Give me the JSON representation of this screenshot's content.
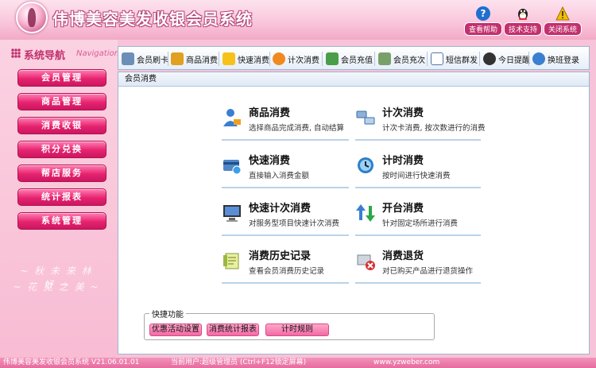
{
  "header": {
    "title": "伟博美容美发收银会员系统",
    "buttons": [
      {
        "label": "查看帮助",
        "icon": "help-icon",
        "color": "#1e6fd0"
      },
      {
        "label": "技术支持",
        "icon": "qq-penguin-icon",
        "color": "#222222"
      },
      {
        "label": "关闭系统",
        "icon": "warning-icon",
        "color": "#f0c000"
      }
    ]
  },
  "sidebar": {
    "title": "系统导航",
    "title_en": "Navigation",
    "items": [
      {
        "label": "会员管理"
      },
      {
        "label": "商品管理"
      },
      {
        "label": "消费收银"
      },
      {
        "label": "积分兑换"
      },
      {
        "label": "帮店服务"
      },
      {
        "label": "统计报表"
      },
      {
        "label": "系统管理"
      }
    ],
    "decoration": [
      "~ 秋 未 来 林 好 ~",
      "~ 花 见 之 美 ~"
    ]
  },
  "toolbar": {
    "items": [
      {
        "label": "会员刷卡",
        "icon": "card-reader-icon"
      },
      {
        "label": "商品消费",
        "icon": "shopping-icon"
      },
      {
        "label": "快速消费",
        "icon": "lightning-icon"
      },
      {
        "label": "计次消费",
        "icon": "refresh-icon"
      },
      {
        "label": "会员充值",
        "icon": "cash-icon"
      },
      {
        "label": "会员充次",
        "icon": "table-icon"
      },
      {
        "label": "短信群发",
        "icon": "envelope-icon"
      },
      {
        "label": "今日提醒",
        "icon": "clock-icon"
      },
      {
        "label": "换班登录",
        "icon": "swap-icon"
      }
    ]
  },
  "panel": {
    "title": "会员消费",
    "cards": [
      {
        "title": "商品消费",
        "desc": "选择商品完成消费, 自动结算",
        "icon": "person-cart-icon"
      },
      {
        "title": "计次消费",
        "desc": "计次卡消费, 按次数进行的消费",
        "icon": "cards-icon"
      },
      {
        "title": "快速消费",
        "desc": "直接输入消费金额",
        "icon": "quick-pay-icon"
      },
      {
        "title": "计时消费",
        "desc": "按时间进行快速消费",
        "icon": "timer-icon"
      },
      {
        "title": "快速计次消费",
        "desc": "对服务型项目快速计次消费",
        "icon": "monitor-icon"
      },
      {
        "title": "开台消费",
        "desc": "针对固定场所进行消费",
        "icon": "sort-arrows-icon"
      },
      {
        "title": "消费历史记录",
        "desc": "查看会员消费历史记录",
        "icon": "notebook-icon"
      },
      {
        "title": "消费退货",
        "desc": "对已购买产品进行退货操作",
        "icon": "return-icon"
      }
    ],
    "quick": {
      "legend": "快捷功能",
      "buttons": [
        {
          "label": "优惠活动设置"
        },
        {
          "label": "消费统计报表"
        },
        {
          "label": "计时规则"
        }
      ]
    }
  },
  "statusbar": {
    "version": "伟博美容美发收银会员系统 V21.06.01.01",
    "user": "当前用户:超级管理员 (Ctrl+F12锁定屏幕)",
    "url": "www.yzweber.com"
  }
}
